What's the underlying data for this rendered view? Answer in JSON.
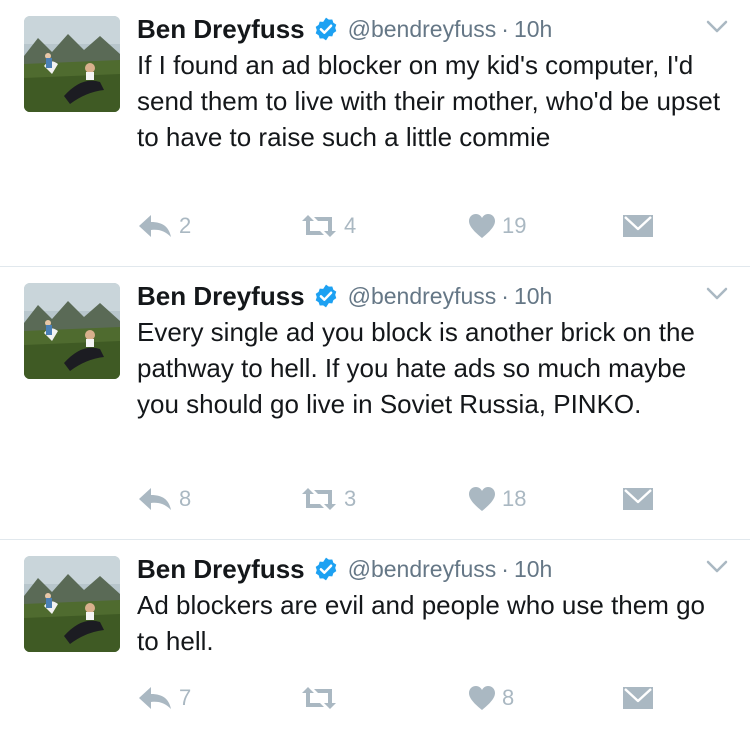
{
  "colors": {
    "name": "#14171a",
    "meta": "#657786",
    "icons": "#aab8c2",
    "verified": "#1da1f2",
    "divider": "#e1e8ed"
  },
  "icons": {
    "avatar": "avatar-photo",
    "verified": "verified-badge-icon",
    "caret": "chevron-down-icon",
    "reply": "reply-icon",
    "retweet": "retweet-icon",
    "like": "heart-icon",
    "dm": "envelope-icon"
  },
  "tweets": [
    {
      "name": "Ben Dreyfuss",
      "handle": "@bendreyfuss",
      "separator": "·",
      "time": "10h",
      "text": "If I found an ad blocker on my kid's computer, I'd send them to live with their mother, who'd be upset to have to raise such a little commie",
      "replies": "2",
      "retweets": "4",
      "likes": "19"
    },
    {
      "name": "Ben Dreyfuss",
      "handle": "@bendreyfuss",
      "separator": "·",
      "time": "10h",
      "text": "Every single ad you block is another brick on the pathway to hell. If you hate ads so much maybe you should go live in Soviet Russia, PINKO.",
      "replies": "8",
      "retweets": "3",
      "likes": "18"
    },
    {
      "name": "Ben Dreyfuss",
      "handle": "@bendreyfuss",
      "separator": "·",
      "time": "10h",
      "text": "Ad blockers are evil and people who use them go to hell.",
      "replies": "7",
      "retweets": "",
      "likes": "8"
    }
  ]
}
